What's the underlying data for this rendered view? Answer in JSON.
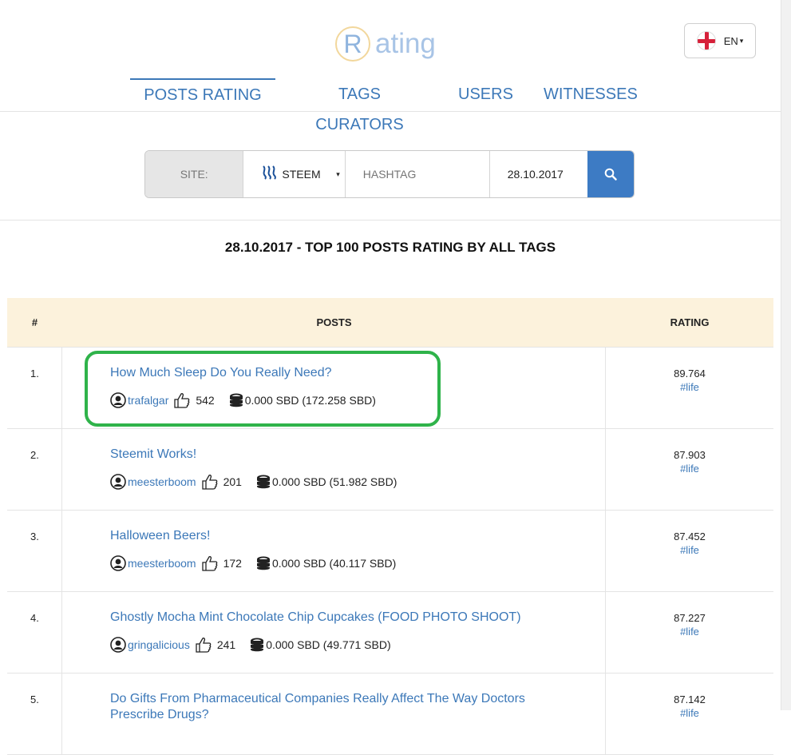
{
  "logo": {
    "letter": "R",
    "text": "ating"
  },
  "lang": {
    "label": "EN"
  },
  "nav": {
    "tabs": [
      {
        "label": "POSTS RATING"
      },
      {
        "label": "TAGS CURATORS"
      },
      {
        "label": "USERS"
      },
      {
        "label": "WITNESSES"
      }
    ]
  },
  "search": {
    "site_label": "SITE:",
    "site_value": "STEEM",
    "hashtag_placeholder": "HASHTAG",
    "date_value": "28.10.2017"
  },
  "heading": "28.10.2017 - TOP 100 POSTS RATING BY ALL TAGS",
  "table": {
    "headers": {
      "num": "#",
      "posts": "POSTS",
      "rating": "RATING"
    },
    "rows": [
      {
        "num": "1.",
        "title": "How Much Sleep Do You Really Need?",
        "author": "trafalgar",
        "votes": "542",
        "payout": "0.000 SBD (172.258 SBD)",
        "rating": "89.764",
        "tag": "#life"
      },
      {
        "num": "2.",
        "title": "Steemit Works!",
        "author": "meesterboom",
        "votes": "201",
        "payout": "0.000 SBD (51.982 SBD)",
        "rating": "87.903",
        "tag": "#life"
      },
      {
        "num": "3.",
        "title": "Halloween Beers!",
        "author": "meesterboom",
        "votes": "172",
        "payout": "0.000 SBD (40.117 SBD)",
        "rating": "87.452",
        "tag": "#life"
      },
      {
        "num": "4.",
        "title": "Ghostly Mocha Mint Chocolate Chip Cupcakes (FOOD PHOTO SHOOT)",
        "author": "gringalicious",
        "votes": "241",
        "payout": "0.000 SBD (49.771 SBD)",
        "rating": "87.227",
        "tag": "#life"
      },
      {
        "num": "5.",
        "title": "Do Gifts From Pharmaceutical Companies Really Affect The Way Doctors Prescribe Drugs?",
        "author": "",
        "votes": "",
        "payout": "",
        "rating": "87.142",
        "tag": "#life"
      }
    ]
  },
  "colors": {
    "accent": "#3c78b8",
    "header_bg": "#fcf2dc",
    "highlight": "#2fb34a",
    "search_button": "#3d7bc4"
  }
}
